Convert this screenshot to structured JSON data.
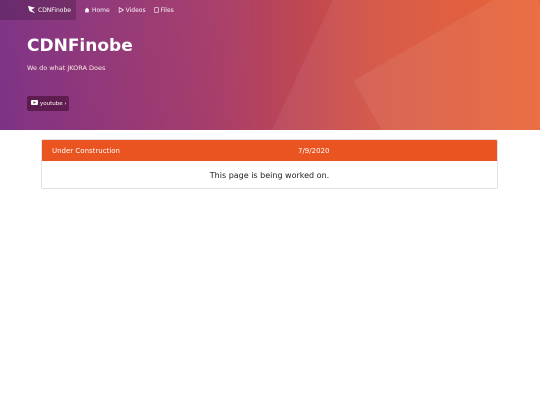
{
  "nav": {
    "brand": "CDNFinobe",
    "items": [
      {
        "label": "Home",
        "icon": "home-icon"
      },
      {
        "label": "Videos",
        "icon": "play-icon"
      },
      {
        "label": "Files",
        "icon": "file-icon"
      }
    ]
  },
  "hero": {
    "title": "CDNFinobe",
    "subtitle": "We do what JKORA Does",
    "button_label": "youtube ›",
    "button_icon": "youtube-icon"
  },
  "notice": {
    "title": "Under Construction",
    "date": "7/9/2020",
    "message": "This page is being worked on."
  },
  "colors": {
    "accent": "#e95420",
    "hero_left": "#7b2d82",
    "hero_right": "#e95b2a"
  }
}
